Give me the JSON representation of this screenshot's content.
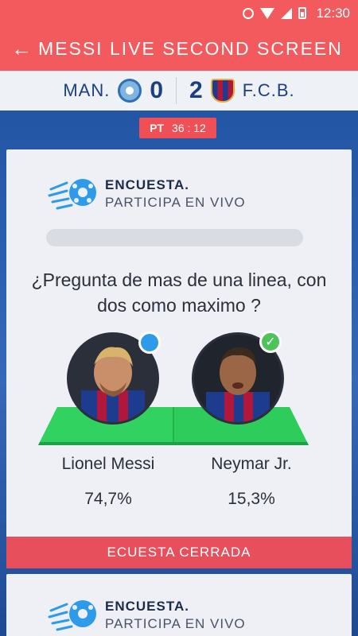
{
  "status_bar": {
    "time": "12:30",
    "icons": [
      "circle-icon",
      "wifi-icon",
      "signal-icon",
      "battery-icon"
    ]
  },
  "app_bar": {
    "title": "MESSI LIVE SECOND SCREEN",
    "back_icon": "arrow-left-icon"
  },
  "scoreboard": {
    "home": {
      "name": "MAN.",
      "score": "0",
      "crest": "manchester-city-crest"
    },
    "away": {
      "name": "F.C.B.",
      "score": "2",
      "crest": "fc-barcelona-crest"
    }
  },
  "match_time": {
    "period": "PT",
    "clock": "36 : 12"
  },
  "poll": {
    "title": "ENCUESTA.",
    "subtitle": "PARTICIPA EN VIVO",
    "question": "¿Pregunta de mas de una linea, con dos como maximo ?",
    "options": [
      {
        "name": "Lionel Messi",
        "percent": "74,7%",
        "selected": "blue-dot"
      },
      {
        "name": "Neymar Jr.",
        "percent": "15,3%",
        "selected": "check-icon"
      }
    ],
    "status_label": "ECUESTA CERRADA"
  },
  "next_poll": {
    "title": "ENCUESTA.",
    "subtitle": "PARTICIPA EN VIVO"
  },
  "colors": {
    "accent": "#f25a5e",
    "background": "#2a5eb0",
    "card": "#eef0f5",
    "field": "#2ecc5a",
    "text_dark": "#1c3f84"
  }
}
